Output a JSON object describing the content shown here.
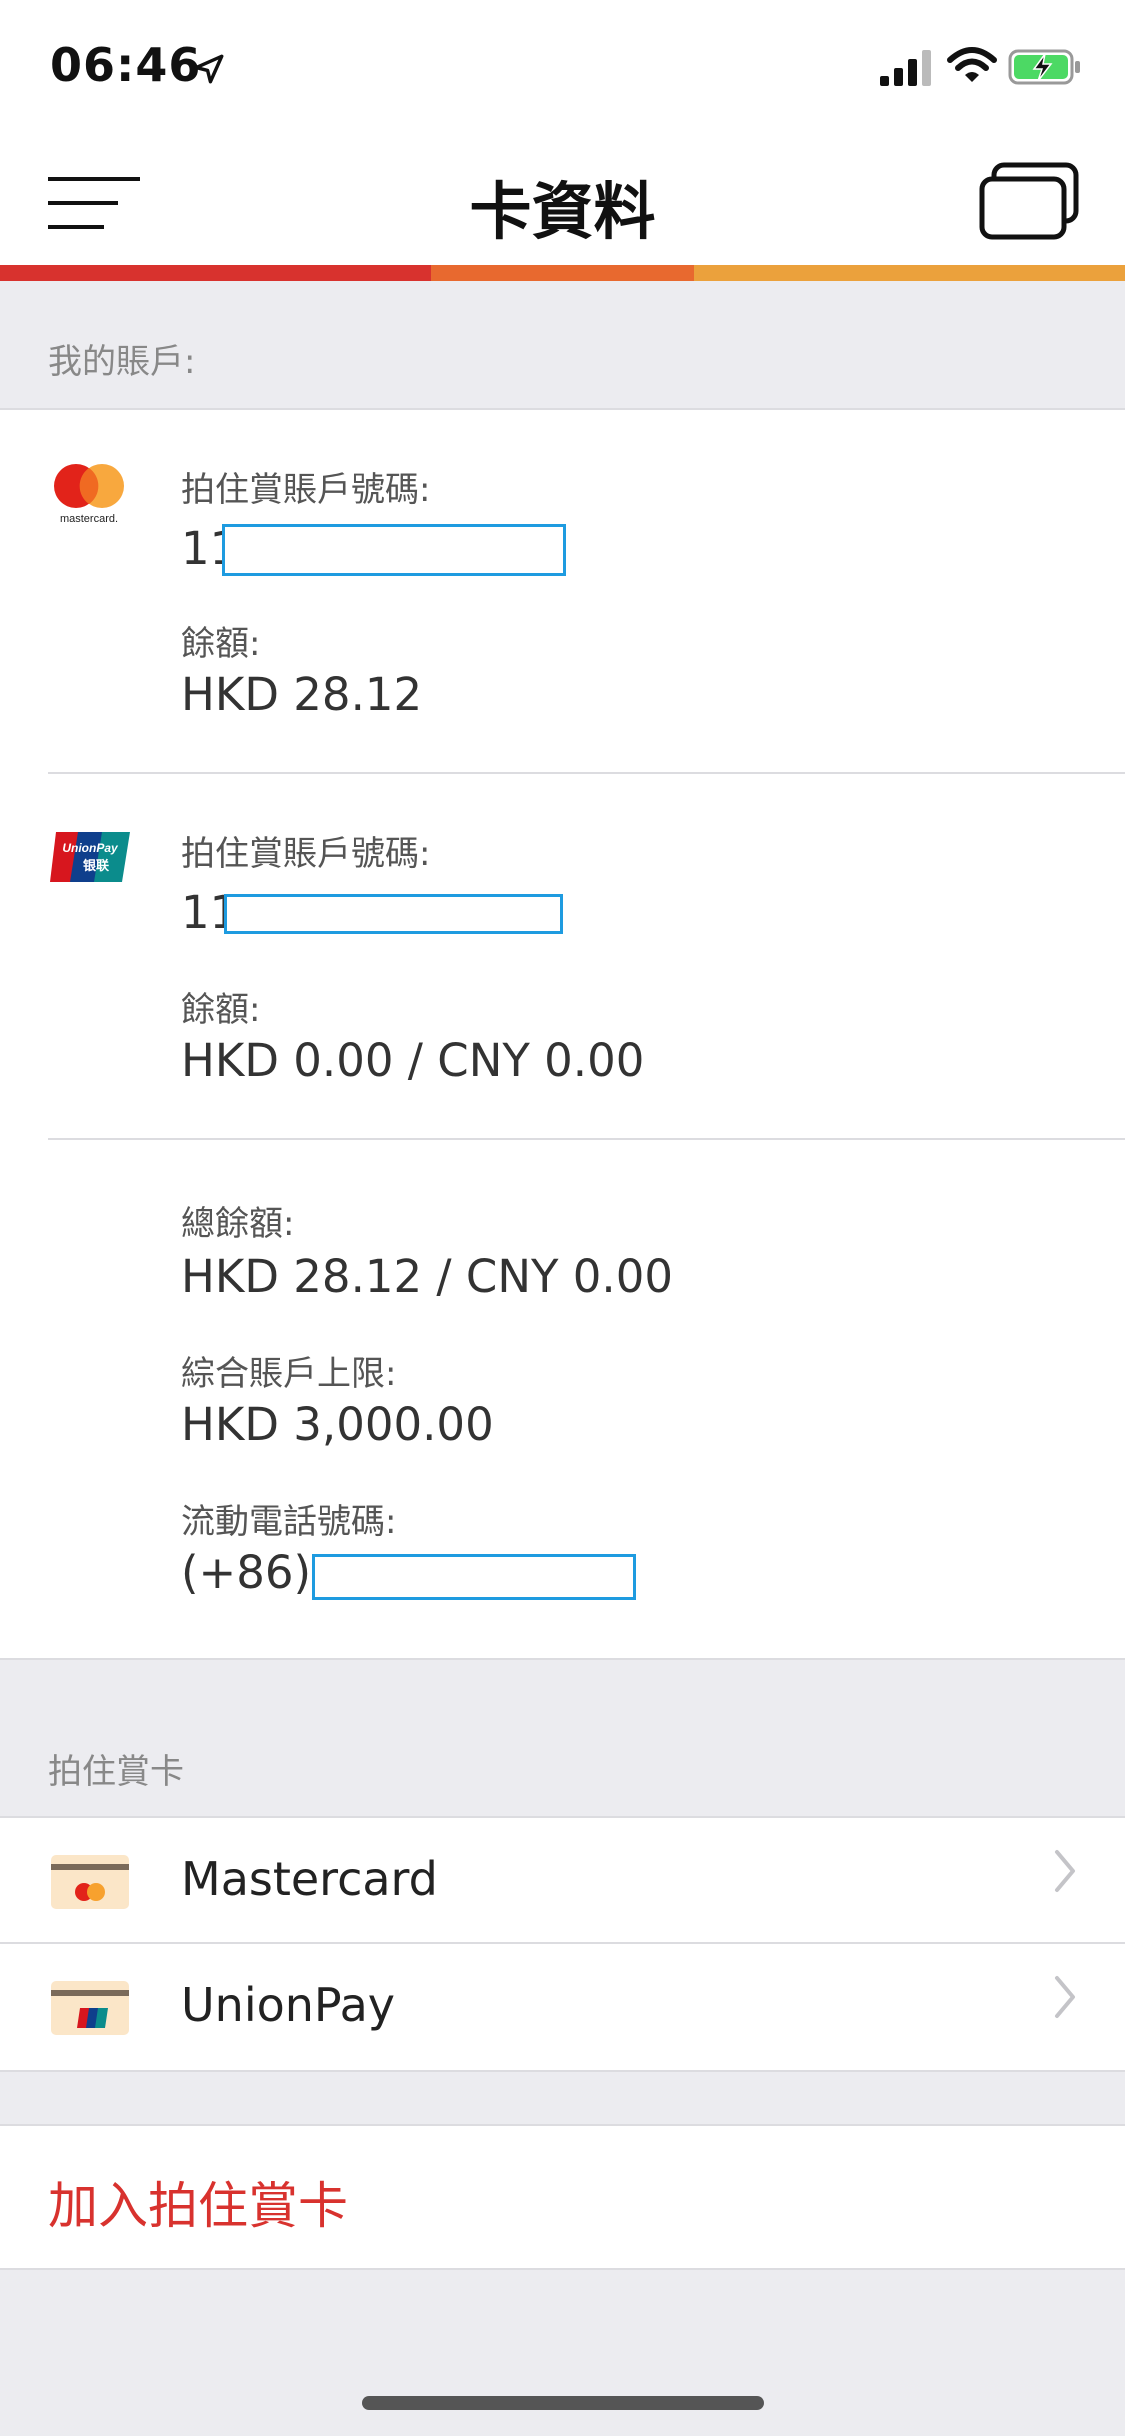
{
  "status_bar": {
    "time": "06:46"
  },
  "header": {
    "title": "卡資料"
  },
  "colors": {
    "accent_red": "#d8322e",
    "accent_orange": "#e8692f",
    "accent_yellow": "#eba13c",
    "link_red": "#d8322e"
  },
  "my_account": {
    "section_title": "我的賬戶:",
    "cards": [
      {
        "brand_icon": "mastercard-logo",
        "account_label": "拍住賞賬戶號碼:",
        "account_prefix": "11",
        "balance_label": "餘額:",
        "balance_value": "HKD 28.12"
      },
      {
        "brand_icon": "unionpay-logo",
        "account_label": "拍住賞賬戶號碼:",
        "account_prefix": "11",
        "balance_label": "餘額:",
        "balance_value": "HKD 0.00 / CNY 0.00"
      }
    ],
    "summary": {
      "total_label": "總餘額:",
      "total_value": "HKD 28.12 / CNY 0.00",
      "limit_label": "綜合賬戶上限:",
      "limit_value": "HKD 3,000.00",
      "phone_label": "流動電話號碼:",
      "phone_prefix": "(+86)"
    }
  },
  "tap_go_cards": {
    "section_title": "拍住賞卡",
    "items": [
      {
        "label": "Mastercard",
        "icon": "mastercard-card-icon"
      },
      {
        "label": "UnionPay",
        "icon": "unionpay-card-icon"
      }
    ]
  },
  "add_card": {
    "label": "加入拍住賞卡"
  }
}
